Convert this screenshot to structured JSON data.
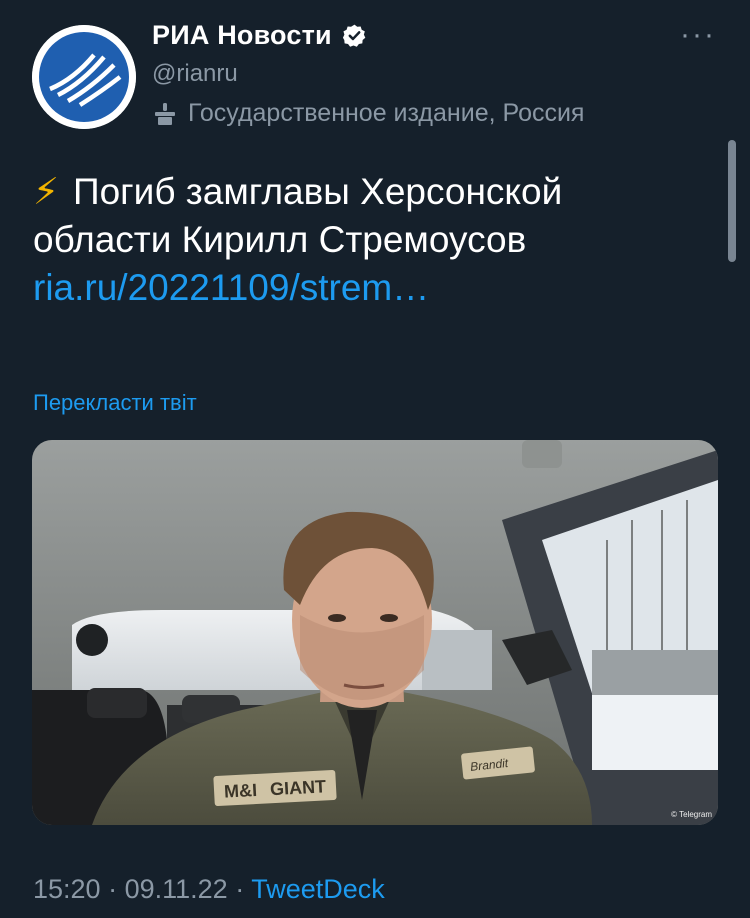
{
  "author": {
    "name": "РИА Новости",
    "handle": "@rianru",
    "label": "Государственное издание, Россия",
    "verified": true
  },
  "icons": {
    "more": "more-dots-icon",
    "verified": "verified-badge-icon",
    "label": "government-podium-icon",
    "avatar": "ria-logo-icon",
    "bolt": "lightning-emoji"
  },
  "tweet": {
    "emoji": "⚡",
    "text": "Погиб замглавы Херсонской области Кирилл Стремоусов",
    "link": "ria.ru/20221109/strem…"
  },
  "translate_label": "Перекласти твіт",
  "media": {
    "alt": "photo",
    "credit": "© Telegram",
    "patch_left": "M&I",
    "patch_text": "GIANT",
    "patch_right": "Brandit"
  },
  "meta": {
    "time": "15:20",
    "separator": " · ",
    "date": "09.11.22",
    "source": "TweetDeck"
  },
  "colors": {
    "background": "#15202b",
    "text": "#ffffff",
    "secondary": "#8b98a5",
    "link": "#1d9bf0",
    "ria_blue": "#1f5fb0"
  }
}
